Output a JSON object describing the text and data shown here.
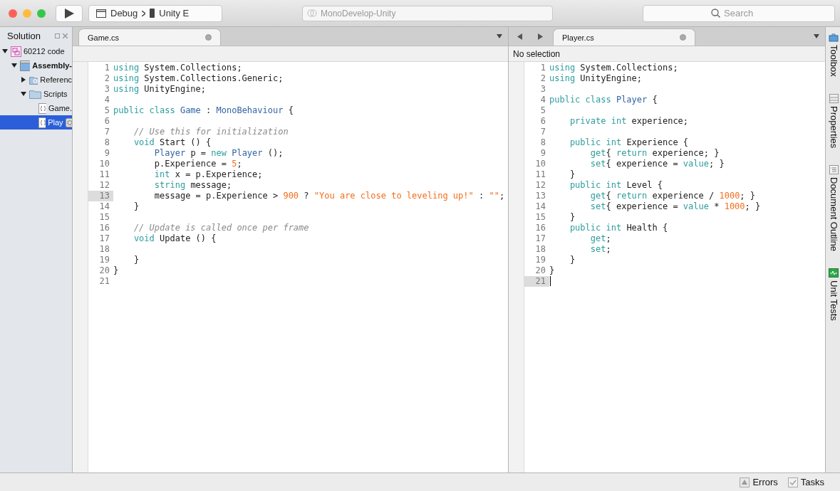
{
  "toolbar": {
    "config": "Debug",
    "target": "Unity E",
    "title": "MonoDevelop-Unity",
    "search": {
      "placeholder": "Search"
    }
  },
  "solution": {
    "title": "Solution",
    "tree": [
      {
        "label": "60212 code",
        "kind": "solution",
        "expanded": true,
        "selected": false,
        "children": [
          {
            "label": "Assembly-",
            "kind": "project",
            "expanded": true,
            "selected": false,
            "children": [
              {
                "label": "Referenc",
                "kind": "references",
                "expanded": false,
                "selected": false
              },
              {
                "label": "Scripts",
                "kind": "folder",
                "expanded": true,
                "selected": false,
                "children": [
                  {
                    "label": "Game.",
                    "kind": "file",
                    "selected": false
                  },
                  {
                    "label": "Play",
                    "kind": "file",
                    "selected": true
                  }
                ]
              }
            ]
          }
        ]
      }
    ]
  },
  "editors": [
    {
      "tabs": [
        {
          "label": "Game.cs",
          "selected": true
        }
      ],
      "navigation": false,
      "lines": [
        {
          "number": "1",
          "current": false,
          "tokens": [
            {
              "kind": "keyword",
              "text": "using"
            },
            {
              "kind": "plain",
              "text": " System.Collections;"
            }
          ]
        },
        {
          "number": "2",
          "current": false,
          "tokens": [
            {
              "kind": "keyword",
              "text": "using"
            },
            {
              "kind": "plain",
              "text": " System.Collections.Generic;"
            }
          ]
        },
        {
          "number": "3",
          "current": false,
          "tokens": [
            {
              "kind": "keyword",
              "text": "using"
            },
            {
              "kind": "plain",
              "text": " UnityEngine;"
            }
          ]
        },
        {
          "number": "4",
          "current": false
        },
        {
          "number": "5",
          "current": false,
          "tokens": [
            {
              "kind": "keyword",
              "text": "public class "
            },
            {
              "kind": "type",
              "text": "Game"
            },
            {
              "kind": "plain",
              "text": " : "
            },
            {
              "kind": "type",
              "text": "MonoBehaviour"
            },
            {
              "kind": "plain",
              "text": " {"
            }
          ]
        },
        {
          "number": "6",
          "current": false
        },
        {
          "number": "7",
          "current": false,
          "tokens": [
            {
              "kind": "comment",
              "text": "    // Use this for initialization"
            }
          ]
        },
        {
          "number": "8",
          "current": false,
          "tokens": [
            {
              "kind": "keyword",
              "text": "    void"
            },
            {
              "kind": "plain",
              "text": " Start () {"
            }
          ]
        },
        {
          "number": "9",
          "current": false,
          "tokens": [
            {
              "kind": "type",
              "text": "        Player"
            },
            {
              "kind": "plain",
              "text": " p = "
            },
            {
              "kind": "keyword",
              "text": "new "
            },
            {
              "kind": "type",
              "text": "Player"
            },
            {
              "kind": "plain",
              "text": " ();"
            }
          ]
        },
        {
          "number": "10",
          "current": false,
          "tokens": [
            {
              "kind": "plain",
              "text": "        p.Experience = "
            },
            {
              "kind": "number",
              "text": "5"
            },
            {
              "kind": "plain",
              "text": ";"
            }
          ]
        },
        {
          "number": "11",
          "current": false,
          "tokens": [
            {
              "kind": "keyword",
              "text": "        int"
            },
            {
              "kind": "plain",
              "text": " x = p.Experience;"
            }
          ]
        },
        {
          "number": "12",
          "current": false,
          "tokens": [
            {
              "kind": "keyword",
              "text": "        string"
            },
            {
              "kind": "plain",
              "text": " message;"
            }
          ]
        },
        {
          "number": "13",
          "current": true,
          "tokens": [
            {
              "kind": "plain",
              "text": "        message = p.Experience > "
            },
            {
              "kind": "number",
              "text": "900"
            },
            {
              "kind": "plain",
              "text": " ? "
            },
            {
              "kind": "string",
              "text": "\"You are close to leveling up!\""
            },
            {
              "kind": "plain",
              "text": " : "
            },
            {
              "kind": "string",
              "text": "\"\""
            },
            {
              "kind": "plain",
              "text": ";"
            }
          ]
        },
        {
          "number": "14",
          "current": false,
          "tokens": [
            {
              "kind": "plain",
              "text": "    }"
            }
          ]
        },
        {
          "number": "15",
          "current": false
        },
        {
          "number": "16",
          "current": false,
          "tokens": [
            {
              "kind": "comment",
              "text": "    // Update is called once per frame"
            }
          ]
        },
        {
          "number": "17",
          "current": false,
          "tokens": [
            {
              "kind": "keyword",
              "text": "    void"
            },
            {
              "kind": "plain",
              "text": " Update () {"
            }
          ]
        },
        {
          "number": "18",
          "current": false
        },
        {
          "number": "19",
          "current": false,
          "tokens": [
            {
              "kind": "plain",
              "text": "    }"
            }
          ]
        },
        {
          "number": "20",
          "current": false,
          "tokens": [
            {
              "kind": "plain",
              "text": "}"
            }
          ]
        },
        {
          "number": "21",
          "current": false
        }
      ]
    },
    {
      "tabs": [
        {
          "label": "Player.cs",
          "selected": true
        }
      ],
      "navigation": true,
      "infobar": "No selection",
      "lines": [
        {
          "number": "1",
          "current": false,
          "tokens": [
            {
              "kind": "keyword",
              "text": "using"
            },
            {
              "kind": "plain",
              "text": " System.Collections;"
            }
          ]
        },
        {
          "number": "2",
          "current": false,
          "tokens": [
            {
              "kind": "keyword",
              "text": "using"
            },
            {
              "kind": "plain",
              "text": " UnityEngine;"
            }
          ]
        },
        {
          "number": "3",
          "current": false
        },
        {
          "number": "4",
          "current": false,
          "tokens": [
            {
              "kind": "keyword",
              "text": "public class "
            },
            {
              "kind": "type",
              "text": "Player"
            },
            {
              "kind": "plain",
              "text": " {"
            }
          ]
        },
        {
          "number": "5",
          "current": false
        },
        {
          "number": "6",
          "current": false,
          "tokens": [
            {
              "kind": "keyword",
              "text": "    private int"
            },
            {
              "kind": "plain",
              "text": " experience;"
            }
          ]
        },
        {
          "number": "7",
          "current": false
        },
        {
          "number": "8",
          "current": false,
          "tokens": [
            {
              "kind": "keyword",
              "text": "    public int"
            },
            {
              "kind": "plain",
              "text": " Experience {"
            }
          ]
        },
        {
          "number": "9",
          "current": false,
          "tokens": [
            {
              "kind": "keyword",
              "text": "        get"
            },
            {
              "kind": "plain",
              "text": "{ "
            },
            {
              "kind": "keyword",
              "text": "return"
            },
            {
              "kind": "plain",
              "text": " experience; }"
            }
          ]
        },
        {
          "number": "10",
          "current": false,
          "tokens": [
            {
              "kind": "keyword",
              "text": "        set"
            },
            {
              "kind": "plain",
              "text": "{ experience = "
            },
            {
              "kind": "keyword",
              "text": "value"
            },
            {
              "kind": "plain",
              "text": "; }"
            }
          ]
        },
        {
          "number": "11",
          "current": false,
          "tokens": [
            {
              "kind": "plain",
              "text": "    }"
            }
          ]
        },
        {
          "number": "12",
          "current": false,
          "tokens": [
            {
              "kind": "keyword",
              "text": "    public int"
            },
            {
              "kind": "plain",
              "text": " Level {"
            }
          ]
        },
        {
          "number": "13",
          "current": false,
          "tokens": [
            {
              "kind": "keyword",
              "text": "        get"
            },
            {
              "kind": "plain",
              "text": "{ "
            },
            {
              "kind": "keyword",
              "text": "return"
            },
            {
              "kind": "plain",
              "text": " experience / "
            },
            {
              "kind": "number",
              "text": "1000"
            },
            {
              "kind": "plain",
              "text": "; }"
            }
          ]
        },
        {
          "number": "14",
          "current": false,
          "tokens": [
            {
              "kind": "keyword",
              "text": "        set"
            },
            {
              "kind": "plain",
              "text": "{ experience = "
            },
            {
              "kind": "keyword",
              "text": "value"
            },
            {
              "kind": "plain",
              "text": " * "
            },
            {
              "kind": "number",
              "text": "1000"
            },
            {
              "kind": "plain",
              "text": "; }"
            }
          ]
        },
        {
          "number": "15",
          "current": false,
          "tokens": [
            {
              "kind": "plain",
              "text": "    }"
            }
          ]
        },
        {
          "number": "16",
          "current": false,
          "tokens": [
            {
              "kind": "keyword",
              "text": "    public int"
            },
            {
              "kind": "plain",
              "text": " Health {"
            }
          ]
        },
        {
          "number": "17",
          "current": false,
          "tokens": [
            {
              "kind": "keyword",
              "text": "        get"
            },
            {
              "kind": "plain",
              "text": ";"
            }
          ]
        },
        {
          "number": "18",
          "current": false,
          "tokens": [
            {
              "kind": "keyword",
              "text": "        set"
            },
            {
              "kind": "plain",
              "text": ";"
            }
          ]
        },
        {
          "number": "19",
          "current": false,
          "tokens": [
            {
              "kind": "plain",
              "text": "    }"
            }
          ]
        },
        {
          "number": "20",
          "current": false,
          "tokens": [
            {
              "kind": "plain",
              "text": "}"
            }
          ]
        },
        {
          "number": "21",
          "current": true
        }
      ]
    }
  ],
  "side_pads": [
    {
      "label": "Toolbox",
      "kind": "toolbox"
    },
    {
      "label": "Properties",
      "kind": "properties"
    },
    {
      "label": "Document Outline",
      "kind": "outline"
    },
    {
      "label": "Unit Tests",
      "kind": "tests"
    }
  ],
  "status_bar": [
    {
      "label": "Errors",
      "kind": "errors"
    },
    {
      "label": "Tasks",
      "kind": "tasks"
    }
  ]
}
